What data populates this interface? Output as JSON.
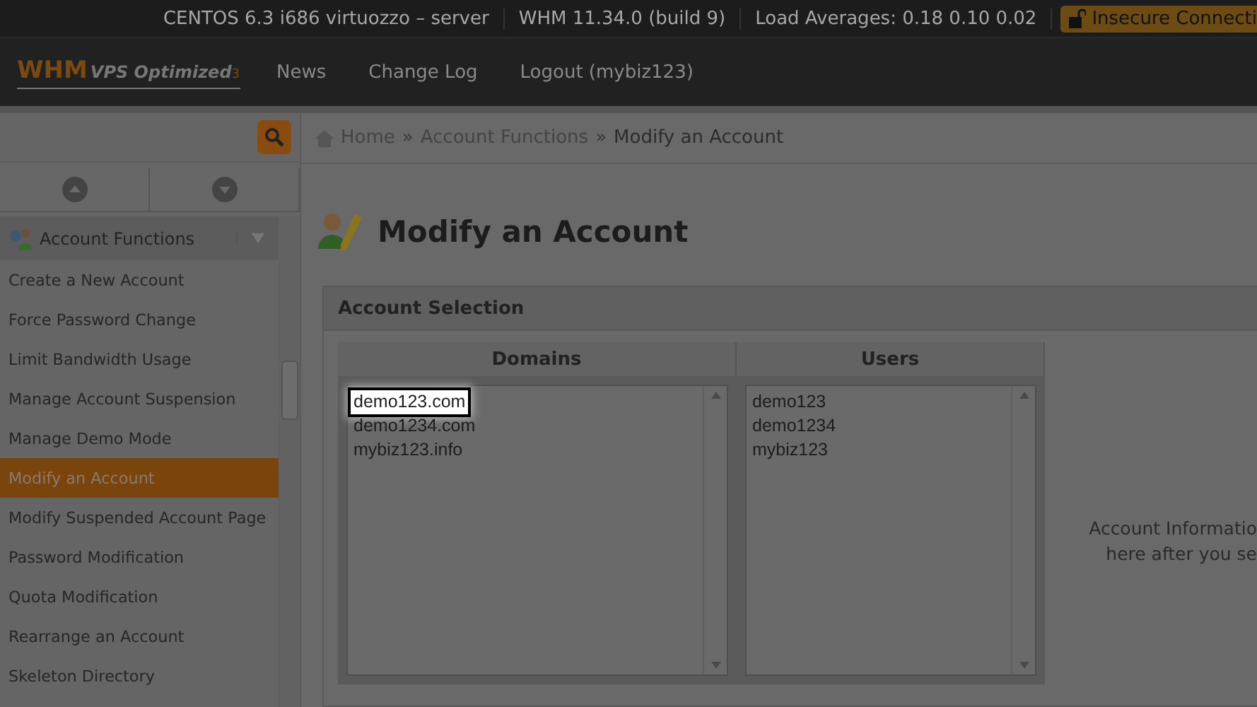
{
  "status_bar": {
    "items": [
      "CENTOS 6.3 i686 virtuozzo – server",
      "WHM 11.34.0 (build 9)",
      "Load Averages: 0.18 0.10 0.02"
    ],
    "warning": "Insecure Connecti"
  },
  "nav": {
    "logo": "WHM",
    "logo_sub": "VPS Optimized",
    "logo_mark": "3",
    "links": [
      "News",
      "Change Log",
      "Logout (mybiz123)"
    ]
  },
  "sidebar": {
    "group": {
      "label": "Account Functions",
      "expanded": true
    },
    "items": [
      {
        "label": "Create a New Account",
        "selected": false
      },
      {
        "label": "Force Password Change",
        "selected": false
      },
      {
        "label": "Limit Bandwidth Usage",
        "selected": false
      },
      {
        "label": "Manage Account Suspension",
        "selected": false
      },
      {
        "label": "Manage Demo Mode",
        "selected": false
      },
      {
        "label": "Modify an Account",
        "selected": true
      },
      {
        "label": "Modify Suspended Account Page",
        "selected": false
      },
      {
        "label": "Password Modification",
        "selected": false
      },
      {
        "label": "Quota Modification",
        "selected": false
      },
      {
        "label": "Rearrange an Account",
        "selected": false
      },
      {
        "label": "Skeleton Directory",
        "selected": false
      }
    ]
  },
  "breadcrumb": [
    "Home",
    "Account Functions",
    "Modify an Account"
  ],
  "breadcrumb_separator": "»",
  "page_title": "Modify an Account",
  "panel": {
    "title": "Account Selection",
    "columns": [
      "Domains",
      "Users"
    ],
    "domains": [
      {
        "label": "demo123.com",
        "selected": true
      },
      {
        "label": "demo1234.com",
        "selected": false
      },
      {
        "label": "mybiz123.info",
        "selected": false
      }
    ],
    "users": [
      {
        "label": "demo123",
        "selected": false
      },
      {
        "label": "demo1234",
        "selected": false
      },
      {
        "label": "mybiz123",
        "selected": false
      }
    ],
    "info": [
      "Account Informatio",
      "here after you se"
    ]
  }
}
